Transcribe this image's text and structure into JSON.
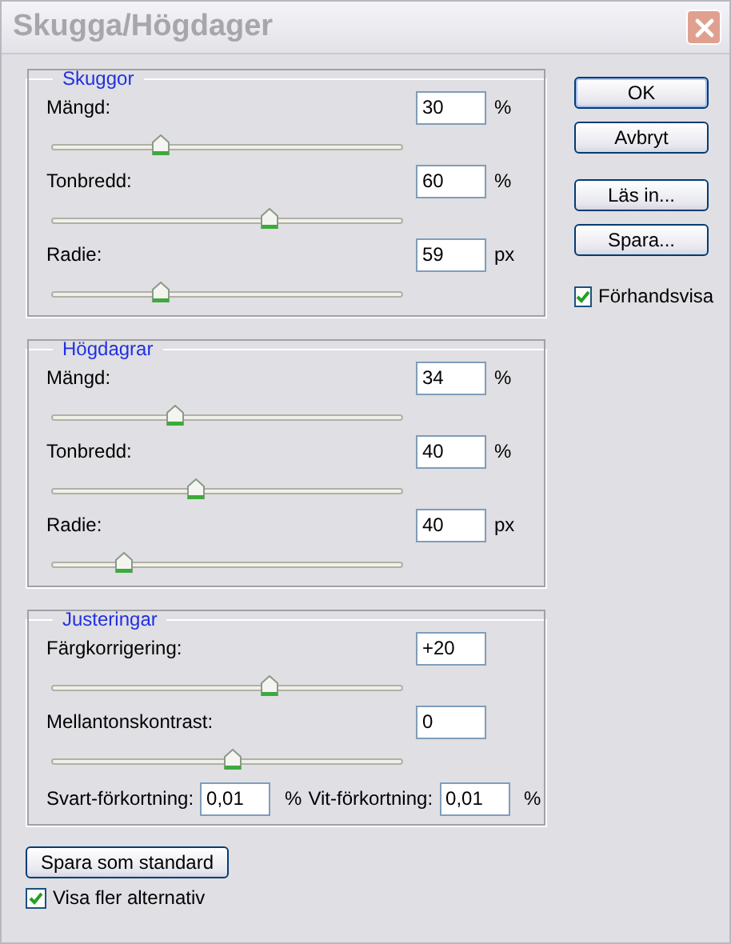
{
  "window": {
    "title": "Skugga/Högdager"
  },
  "groups": [
    {
      "title": "Skuggor",
      "rows": [
        {
          "kind": "slider",
          "label": "Mängd:",
          "value": "30",
          "unit": "%",
          "level": 0.3
        },
        {
          "kind": "slider",
          "label": "Tonbredd:",
          "value": "60",
          "unit": "%",
          "level": 0.6
        },
        {
          "kind": "slider",
          "label": "Radie:",
          "value": "59",
          "unit": "px",
          "level": 0.3
        }
      ]
    },
    {
      "title": "Högdagrar",
      "rows": [
        {
          "kind": "slider",
          "label": "Mängd:",
          "value": "34",
          "unit": "%",
          "level": 0.34
        },
        {
          "kind": "slider",
          "label": "Tonbredd:",
          "value": "40",
          "unit": "%",
          "level": 0.4
        },
        {
          "kind": "slider",
          "label": "Radie:",
          "value": "40",
          "unit": "px",
          "level": 0.2
        }
      ]
    },
    {
      "title": "Justeringar",
      "rows": [
        {
          "kind": "slider",
          "label": "Färgkorrigering:",
          "value": "+20",
          "level": 0.6
        },
        {
          "kind": "slider",
          "label": "Mellantonskontrast:",
          "value": "0",
          "level": 0.5
        },
        {
          "kind": "pair",
          "fields": [
            {
              "label": "Svart-förkortning:",
              "value": "0,01",
              "unit": "%"
            },
            {
              "label": "Vit-förkortning:",
              "value": "0,01",
              "unit": "%"
            }
          ]
        }
      ]
    }
  ],
  "buttons": [
    {
      "label": "OK",
      "default": true
    },
    {
      "label": "Avbryt",
      "default": false
    },
    {
      "label": "Läs in...",
      "default": false
    },
    {
      "label": "Spara...",
      "default": false
    }
  ],
  "preview": {
    "label": "Förhandsvisa",
    "checked": true
  },
  "save_default": {
    "label": "Spara som standard"
  },
  "more_options": {
    "label": "Visa fler alternativ",
    "checked": true
  }
}
